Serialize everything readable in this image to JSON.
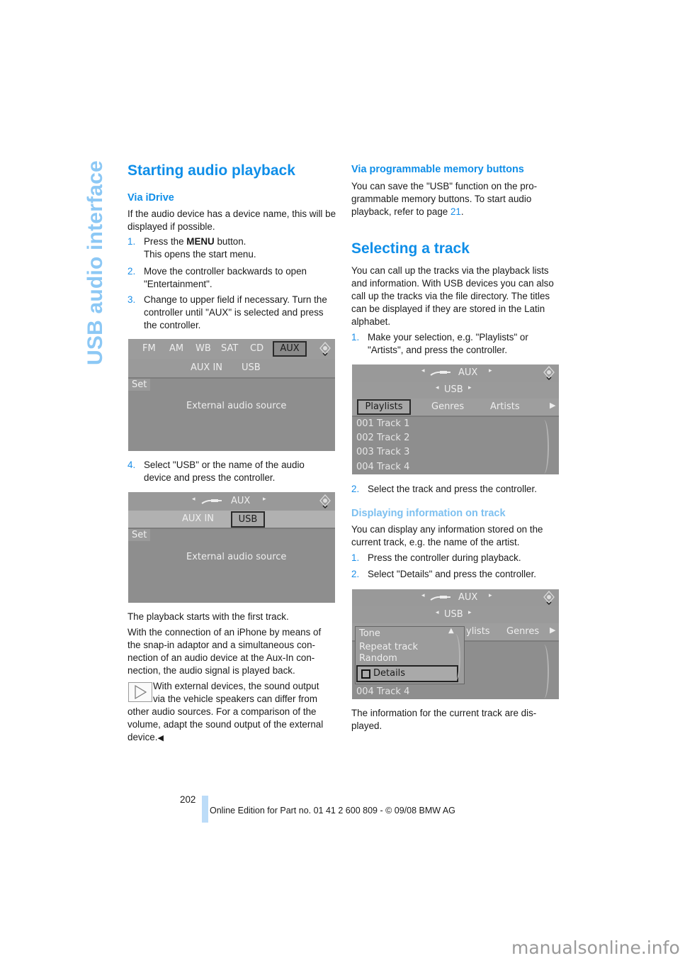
{
  "sidebar": {
    "title": "USB audio interface"
  },
  "left": {
    "heading": "Starting audio playback",
    "subheading": "Via iDrive",
    "intro": "If the audio device has a device name, this will be displayed if possible.",
    "steps": [
      {
        "num": "1.",
        "line1_pre": "Press the ",
        "line1_bold": "MENU",
        "line1_post": " button.",
        "line2": "This opens the start menu."
      },
      {
        "num": "2.",
        "text": "Move the controller backwards to open \"Entertainment\"."
      },
      {
        "num": "3.",
        "text": "Change to upper field if necessary. Turn the controller until \"AUX\" is selected and press the controller."
      },
      {
        "num": "4.",
        "text": "Select \"USB\" or the name of the audio device and press the controller."
      }
    ],
    "screen1": {
      "tabs": [
        "FM",
        "AM",
        "WB",
        "SAT",
        "CD",
        "AUX"
      ],
      "selected_tab": "AUX",
      "subtabs": [
        "AUX IN",
        "USB"
      ],
      "set_label": "Set",
      "body": "External audio source"
    },
    "screen2": {
      "header": "AUX",
      "subtabs": [
        "AUX IN",
        "USB"
      ],
      "selected_subtab": "USB",
      "set_label": "Set",
      "body": "External audio source"
    },
    "para1": "The playback starts with the first track.",
    "para2": "With the connection of an iPhone by means of the snap-in adaptor and a simultaneous con-nection of an audio device at the Aux-In con-nection, the audio signal is played back.",
    "note_first": "With external devices, the sound output",
    "note_second": "via the vehicle speakers can differ from",
    "note_rest": "other audio sources. For a comparison of the volume, adapt the sound output of the external device.",
    "note_end_mark": "◀"
  },
  "right": {
    "sub1": "Via programmable memory buttons",
    "sub1_text_pre": "You can save the \"USB\" function on the pro-grammable memory buttons. To start audio playback, refer to page ",
    "sub1_link": "21",
    "sub1_text_post": ".",
    "heading": "Selecting a track",
    "intro": "You can call up the tracks via the playback lists and information. With USB devices you can also call up the tracks via the file directory. The titles can be displayed if they are stored in the Latin alphabet.",
    "steps_a": [
      {
        "num": "1.",
        "text": "Make your selection, e.g. \"Playlists\" or \"Artists\", and press the controller."
      },
      {
        "num": "2.",
        "text": "Select the track and press the controller."
      }
    ],
    "screen3": {
      "header": "AUX",
      "source": "USB",
      "tabs": [
        "Playlists",
        "Genres",
        "Artists"
      ],
      "selected_tab": "Playlists",
      "tracks": [
        "001 Track 1",
        "002 Track 2",
        "003 Track 3",
        "004 Track 4"
      ]
    },
    "sub2": "Displaying information on track",
    "sub2_text": "You can display any information stored on the current track, e.g. the name of the artist.",
    "steps_b": [
      {
        "num": "1.",
        "text": "Press the controller during playback."
      },
      {
        "num": "2.",
        "text": "Select \"Details\" and press the controller."
      }
    ],
    "screen4": {
      "header": "AUX",
      "source": "USB",
      "tabs_visible": [
        "ylists",
        "Genres"
      ],
      "popup_items": [
        "Tone",
        "Repeat track",
        "Random",
        "Details"
      ],
      "selected_popup_item": "Details",
      "track_visible": "004 Track 4"
    },
    "outro": "The information for the current track are dis-played."
  },
  "footer": {
    "page_number": "202",
    "edition": "Online Edition for Part no. 01 41 2 600 809 - © 09/08 BMW AG"
  },
  "watermark": "manualsonline.info",
  "colors": {
    "accent": "#0f8ee8",
    "sidebar": "#8cc8f5",
    "screen_bg": "#8e8e8e"
  }
}
